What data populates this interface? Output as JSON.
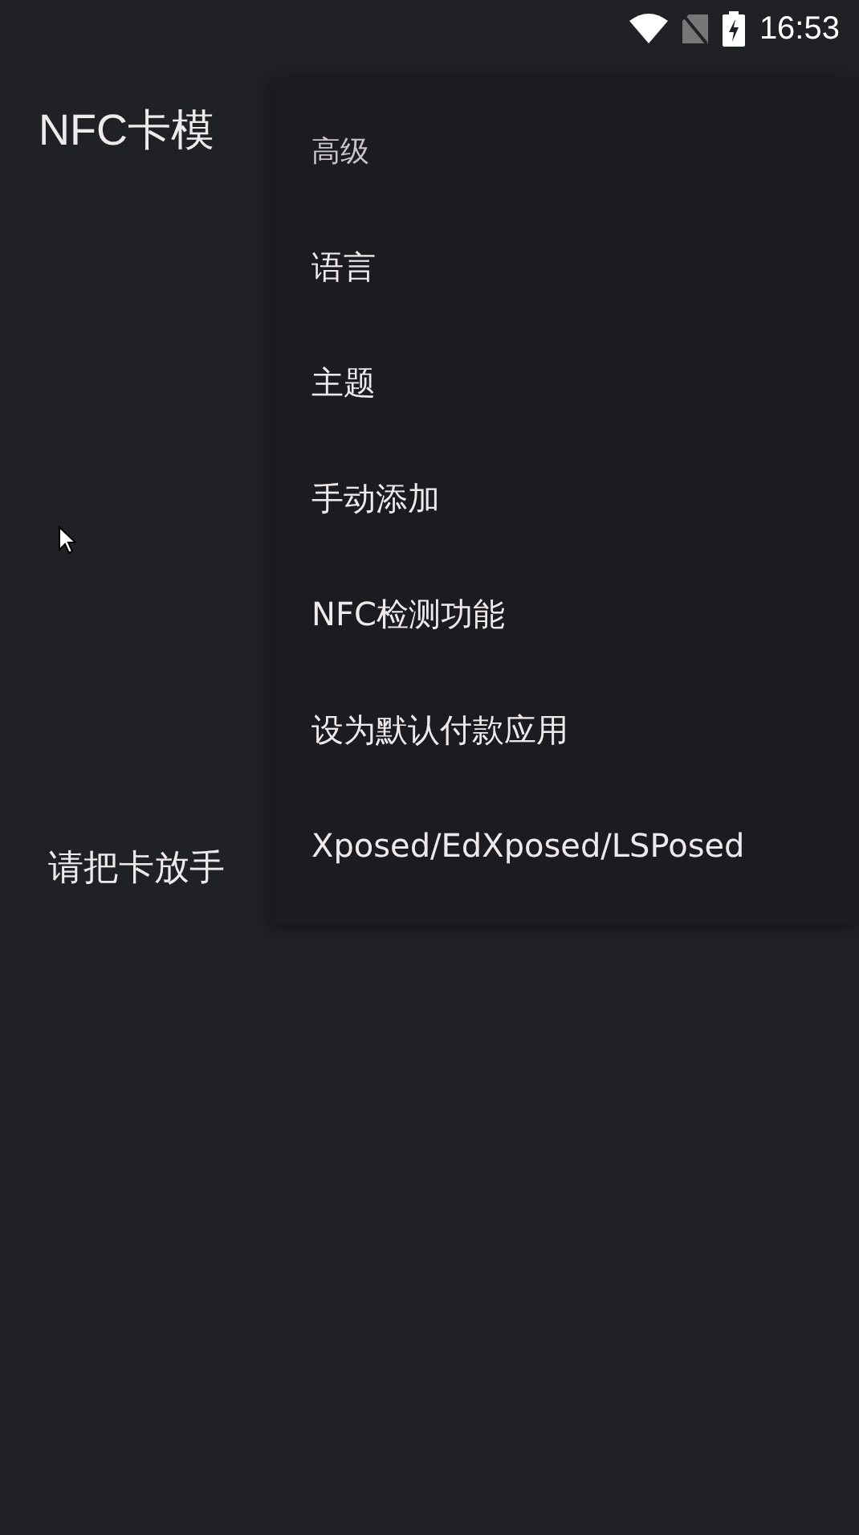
{
  "status_bar": {
    "time": "16:53"
  },
  "app_bar": {
    "title": "NFC卡模"
  },
  "body": {
    "prompt": "请把卡放手"
  },
  "menu": {
    "header": "高级",
    "items": [
      {
        "label": "语言"
      },
      {
        "label": "主题"
      },
      {
        "label": "手动添加"
      },
      {
        "label": "NFC检测功能"
      },
      {
        "label": "设为默认付款应用"
      },
      {
        "label": "Xposed/EdXposed/LSPosed"
      }
    ]
  }
}
